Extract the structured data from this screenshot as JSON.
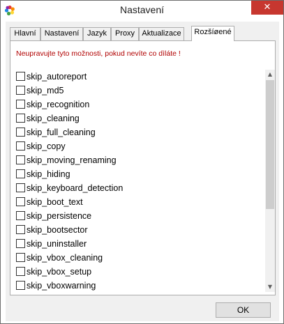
{
  "window": {
    "title": "Nastavení",
    "close_glyph": "✕"
  },
  "tabs": [
    {
      "label": "Hlavní",
      "active": false
    },
    {
      "label": "Nastavení",
      "active": false
    },
    {
      "label": "Jazyk",
      "active": false
    },
    {
      "label": "Proxy",
      "active": false
    },
    {
      "label": "Aktualizace",
      "active": false
    },
    {
      "label": "Rozšíøené",
      "active": true
    }
  ],
  "panel": {
    "warning": "Neupravujte tyto možnosti, pokud nevíte co dìláte !"
  },
  "options": [
    {
      "label": "skip_autoreport",
      "checked": false
    },
    {
      "label": "skip_md5",
      "checked": false
    },
    {
      "label": "skip_recognition",
      "checked": false
    },
    {
      "label": "skip_cleaning",
      "checked": false
    },
    {
      "label": "skip_full_cleaning",
      "checked": false
    },
    {
      "label": "skip_copy",
      "checked": false
    },
    {
      "label": "skip_moving_renaming",
      "checked": false
    },
    {
      "label": "skip_hiding",
      "checked": false
    },
    {
      "label": "skip_keyboard_detection",
      "checked": false
    },
    {
      "label": "skip_boot_text",
      "checked": false
    },
    {
      "label": "skip_persistence",
      "checked": false
    },
    {
      "label": "skip_bootsector",
      "checked": false
    },
    {
      "label": "skip_uninstaller",
      "checked": false
    },
    {
      "label": "skip_vbox_cleaning",
      "checked": false
    },
    {
      "label": "skip_vbox_setup",
      "checked": false
    },
    {
      "label": "skip_vboxwarning",
      "checked": false
    }
  ],
  "scrollbar": {
    "up_glyph": "▲",
    "down_glyph": "▼"
  },
  "buttons": {
    "ok": "OK"
  },
  "colors": {
    "warning": "#b00000",
    "close": "#c7372f"
  }
}
